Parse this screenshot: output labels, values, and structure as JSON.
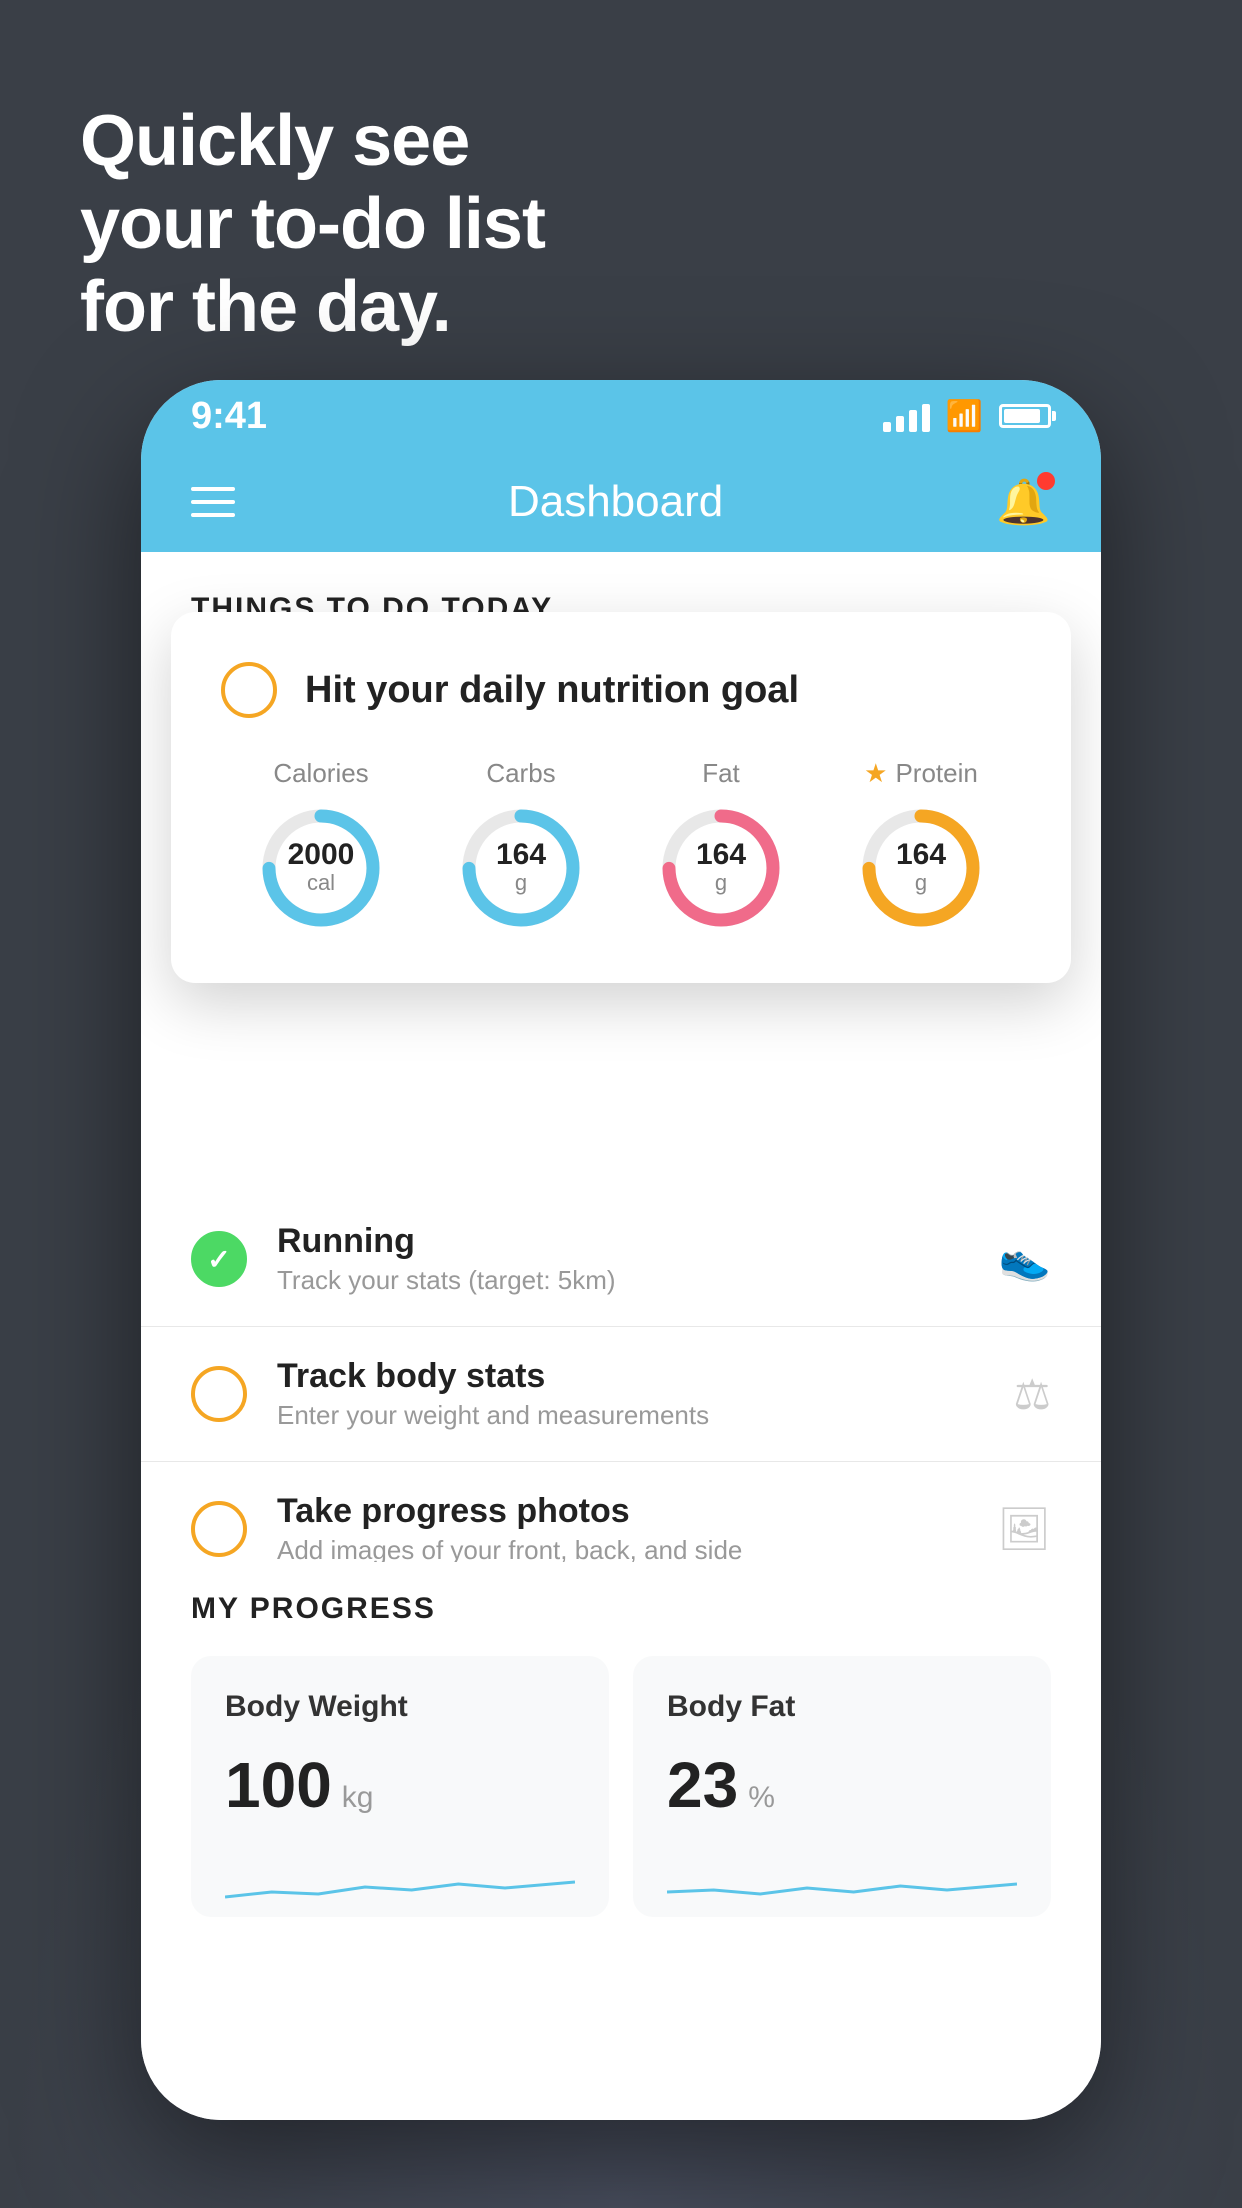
{
  "background": {
    "color": "#3a3f47"
  },
  "headline": {
    "line1": "Quickly see",
    "line2": "your to-do list",
    "line3": "for the day."
  },
  "phone": {
    "status_bar": {
      "time": "9:41"
    },
    "nav_bar": {
      "title": "Dashboard"
    },
    "things_section": {
      "header": "THINGS TO DO TODAY"
    },
    "nutrition_card": {
      "title": "Hit your daily nutrition goal",
      "macros": [
        {
          "label": "Calories",
          "value": "2000",
          "unit": "cal",
          "color": "blue",
          "starred": false
        },
        {
          "label": "Carbs",
          "value": "164",
          "unit": "g",
          "color": "blue",
          "starred": false
        },
        {
          "label": "Fat",
          "value": "164",
          "unit": "g",
          "color": "pink",
          "starred": false
        },
        {
          "label": "Protein",
          "value": "164",
          "unit": "g",
          "color": "yellow",
          "starred": true
        }
      ]
    },
    "todo_items": [
      {
        "name": "Running",
        "sub": "Track your stats (target: 5km)",
        "checked": true,
        "circle": "green"
      },
      {
        "name": "Track body stats",
        "sub": "Enter your weight and measurements",
        "checked": false,
        "circle": "yellow"
      },
      {
        "name": "Take progress photos",
        "sub": "Add images of your front, back, and side",
        "checked": false,
        "circle": "yellow"
      }
    ],
    "progress_section": {
      "header": "MY PROGRESS",
      "cards": [
        {
          "title": "Body Weight",
          "value": "100",
          "unit": "kg"
        },
        {
          "title": "Body Fat",
          "value": "23",
          "unit": "%"
        }
      ]
    }
  }
}
